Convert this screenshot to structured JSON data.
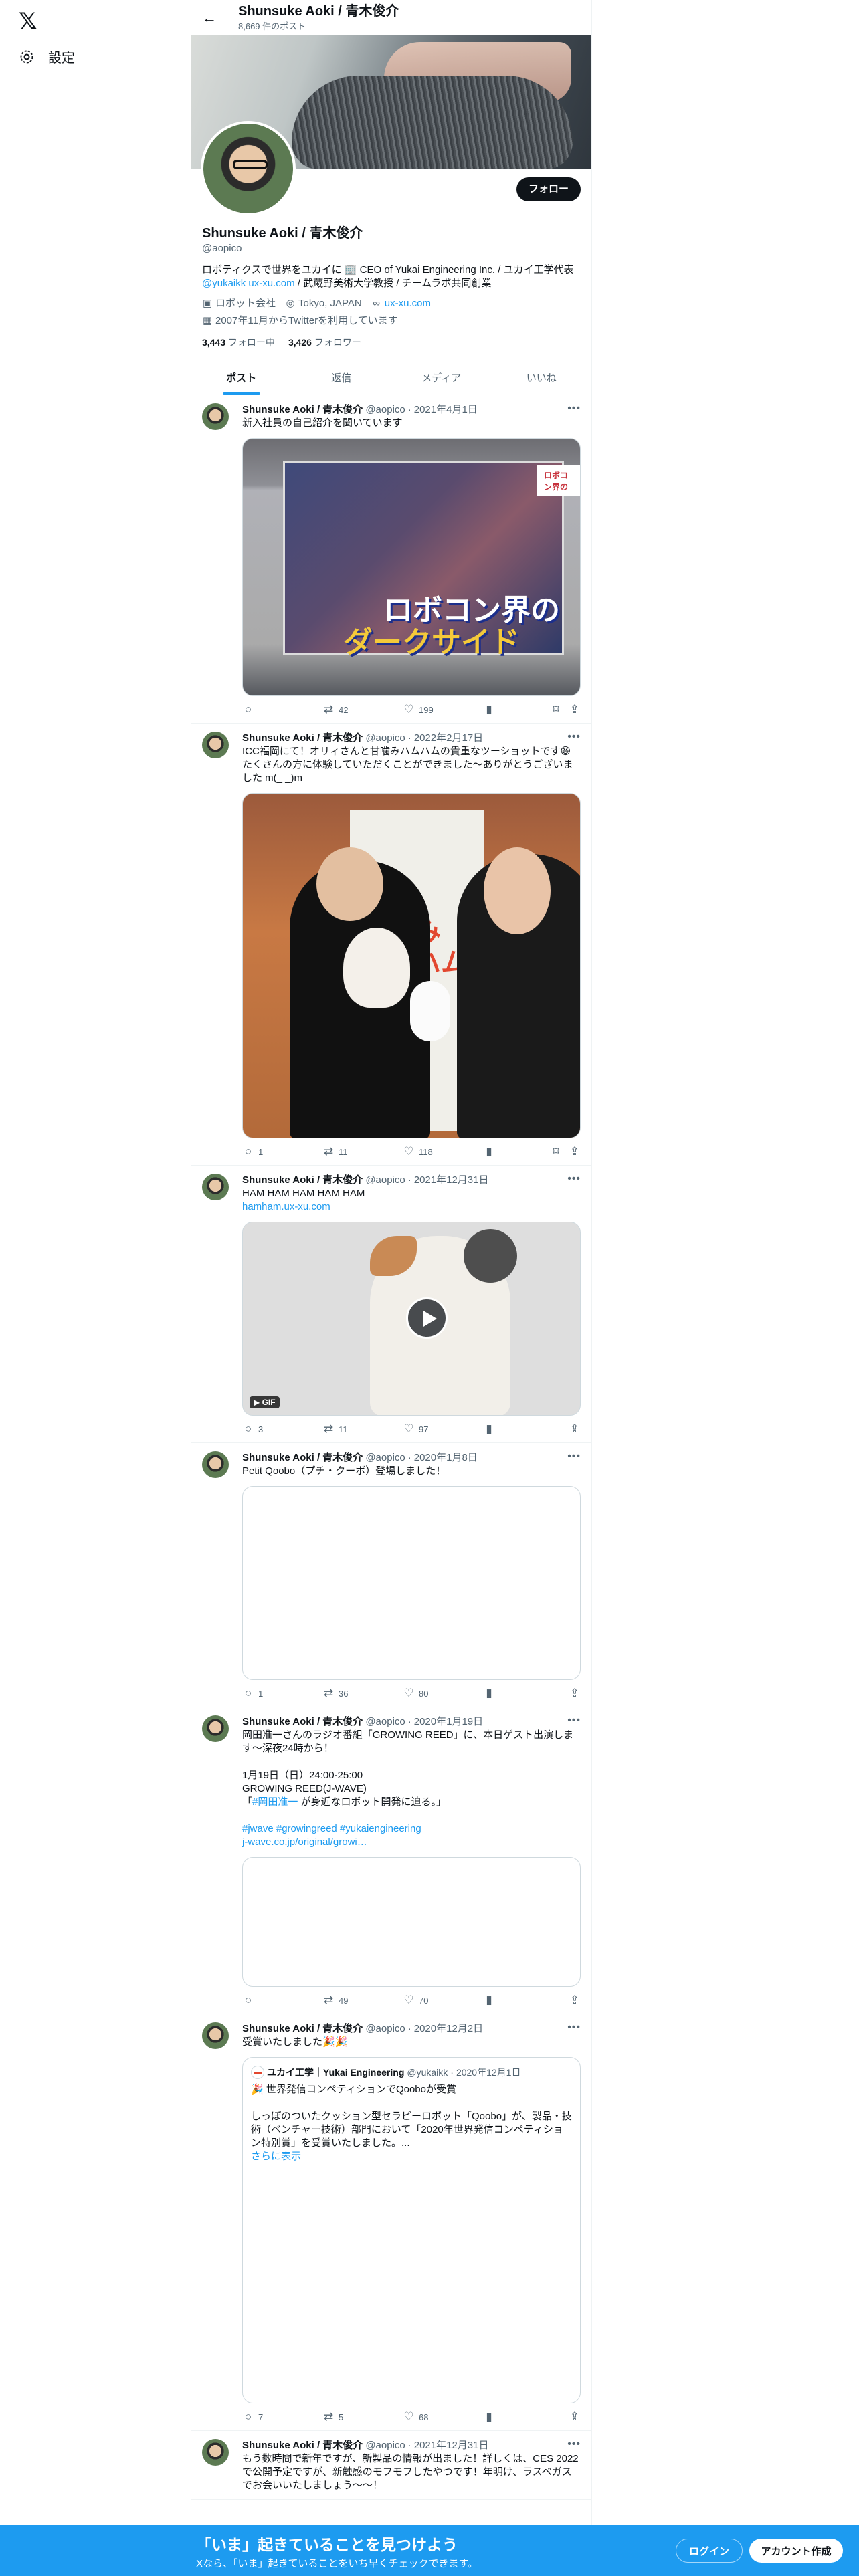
{
  "nav": {
    "logo": "𝕏",
    "settings": "設定"
  },
  "topbar": {
    "name": "Shunsuke Aoki / 青木俊介",
    "posts": "8,669 件のポスト"
  },
  "profile": {
    "follow": "フォロー",
    "name": "Shunsuke Aoki / 青木俊介",
    "handle": "@aopico",
    "bio1": "ロボティクスで世界をユカイに 🏢 CEO of Yukai Engineering Inc. / ユカイ工学代表",
    "bio_link": "@yukaikk",
    "bio_link2": "ux-xu.com",
    "bio2": " / 武蔵野美術大学教授 / チームラボ共同創業",
    "meta": {
      "company": "ロボット会社",
      "location": "Tokyo, JAPAN",
      "url": "ux-xu.com",
      "joined": "2007年11月からTwitterを利用しています"
    },
    "following_count": "3,443",
    "following_label": "フォロー中",
    "followers_count": "3,426",
    "followers_label": "フォロワー"
  },
  "tabs": [
    "ポスト",
    "返信",
    "メディア",
    "いいね"
  ],
  "posts": [
    {
      "name": "Shunsuke Aoki / 青木俊介",
      "handle": "@aopico",
      "date": "2021年4月1日",
      "text": "新入社員の自己紹介を聞いています",
      "media": {
        "tag": "ロボコン界の",
        "line1": "ロボコン界の",
        "line2": "ダークサイド"
      },
      "replies": "",
      "reposts": "42",
      "likes": "199"
    },
    {
      "name": "Shunsuke Aoki / 青木俊介",
      "handle": "@aopico",
      "date": "2022年2月17日",
      "text": "ICC福岡にて！オリィさんと甘噛みハムハムの貴重なツーショットです😆 たくさんの方に体験していただくことができました〜ありがとうございました m(_ _)m",
      "media": {
        "sign": "甘噛み\nハムハム"
      },
      "replies": "1",
      "reposts": "11",
      "likes": "118"
    },
    {
      "name": "Shunsuke Aoki / 青木俊介",
      "handle": "@aopico",
      "date": "2021年12月31日",
      "text": "HAM HAM HAM HAM HAM",
      "link": "hamham.ux-xu.com",
      "gif": "GIF",
      "replies": "3",
      "reposts": "11",
      "likes": "97"
    },
    {
      "name": "Shunsuke Aoki / 青木俊介",
      "handle": "@aopico",
      "date": "2020年1月8日",
      "text": "Petit Qoobo（プチ・クーボ）登場しました！",
      "replies": "1",
      "reposts": "36",
      "likes": "80"
    },
    {
      "name": "Shunsuke Aoki / 青木俊介",
      "handle": "@aopico",
      "date": "2020年1月19日",
      "text": "岡田准一さんのラジオ番組「GROWING REED」に、本日ゲスト出演します〜深夜24時から！\n\n1月19日（日）24:00-25:00\nGROWING REED(J-WAVE)",
      "text2a": "「",
      "text2link": "#岡田准一",
      "text2b": " が身近なロボット開発に迫る。」",
      "hashtags": "#jwave #growingreed #yukaiengineering",
      "link": "j-wave.co.jp/original/growi…",
      "replies": "",
      "reposts": "49",
      "likes": "70"
    },
    {
      "name": "Shunsuke Aoki / 青木俊介",
      "handle": "@aopico",
      "date": "2020年12月2日",
      "text": "受賞いたしました🎉🎉",
      "quote": {
        "name": "ユカイ工学｜Yukai Engineering",
        "handle": "@yukaikk",
        "date": "2020年12月1日",
        "text": "🎉 世界発信コンペティションでQooboが受賞\n\nしっぽのついたクッション型セラピーロボット「Qoobo」が、製品・技術（ベンチャー技術）部門において「2020年世界発信コンペティション特別賞」を受賞いたしました。...",
        "more": "さらに表示"
      },
      "replies": "7",
      "reposts": "5",
      "likes": "68"
    },
    {
      "name": "Shunsuke Aoki / 青木俊介",
      "handle": "@aopico",
      "date": "2021年12月31日",
      "text": "もう数時間で新年ですが、新製品の情報が出ました！詳しくは、CES 2022で公開予定ですが、新触感のモフモフしたやつです！年明け、ラスベガスでお会いいたしましょう〜〜！"
    }
  ],
  "bottom": {
    "title": "「いま」起きていることを見つけよう",
    "sub": "Xなら、「いま」起きていることをいち早くチェックできます。",
    "login": "ログイン",
    "signup": "アカウント作成"
  },
  "colors": {
    "accent": "#1d9bf0",
    "text": "#0f1419",
    "muted": "#536471"
  }
}
